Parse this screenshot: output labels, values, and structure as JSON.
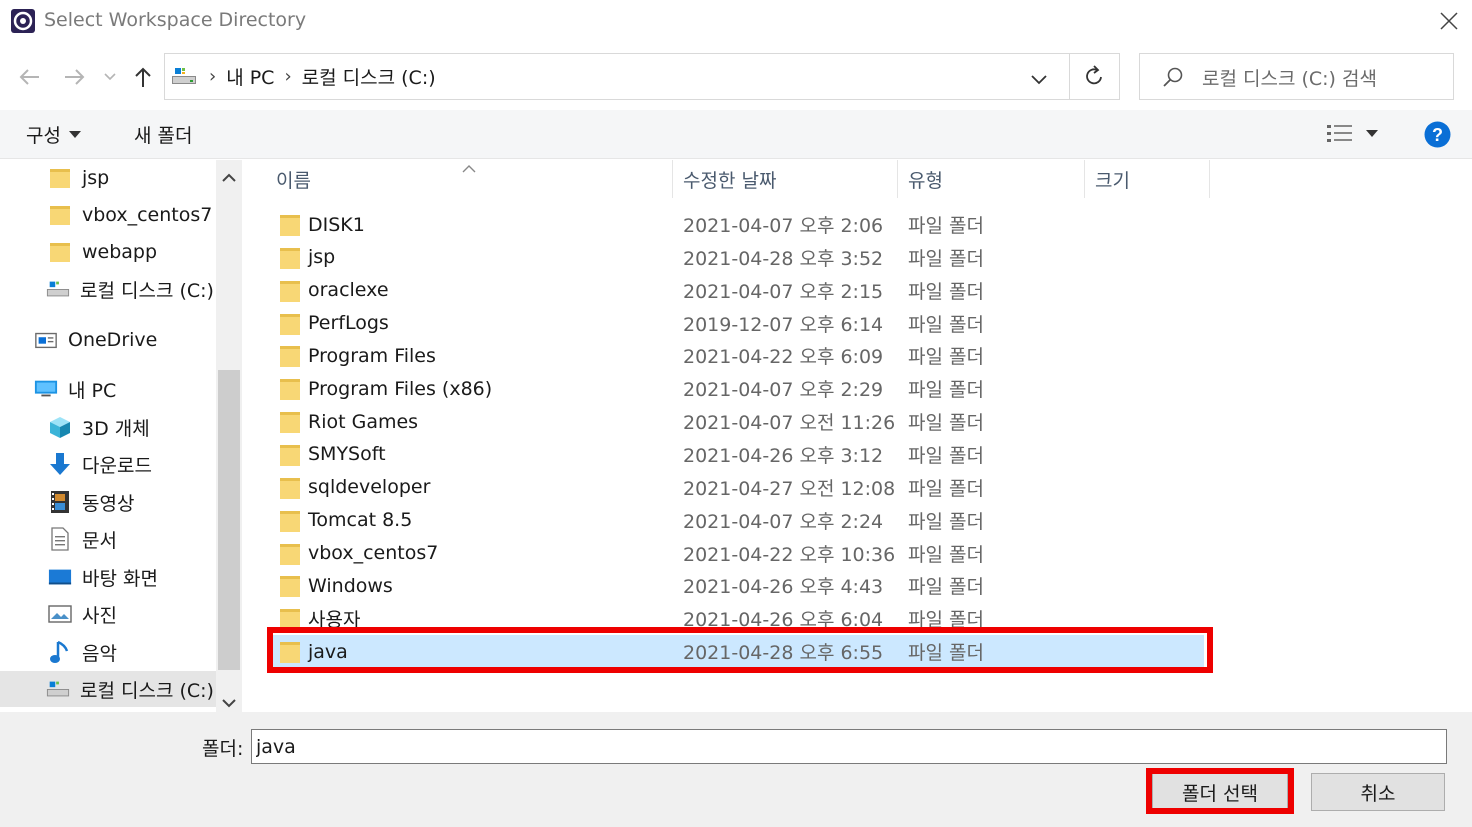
{
  "window": {
    "title": "Select Workspace Directory"
  },
  "address": {
    "crumbs": [
      "내 PC",
      "로컬 디스크 (C:)"
    ],
    "search_placeholder": "로컬 디스크 (C:) 검색"
  },
  "commands": {
    "organize": "구성",
    "new_folder": "새 폴더"
  },
  "nav": {
    "items": [
      {
        "label": "jsp",
        "icon": "folder-icon"
      },
      {
        "label": "vbox_centos7",
        "icon": "folder-icon"
      },
      {
        "label": "webapp",
        "icon": "folder-icon"
      },
      {
        "label": "로컬 디스크 (C:)",
        "icon": "drive-icon"
      },
      {
        "label": "OneDrive",
        "icon": "onedrive-icon"
      },
      {
        "label": "내 PC",
        "icon": "pc-icon"
      },
      {
        "label": "3D 개체",
        "icon": "cube-icon"
      },
      {
        "label": "다운로드",
        "icon": "download-icon"
      },
      {
        "label": "동영상",
        "icon": "video-icon"
      },
      {
        "label": "문서",
        "icon": "document-icon"
      },
      {
        "label": "바탕 화면",
        "icon": "desktop-icon"
      },
      {
        "label": "사진",
        "icon": "picture-icon"
      },
      {
        "label": "음악",
        "icon": "music-icon"
      },
      {
        "label": "로컬 디스크 (C:)",
        "icon": "drive-icon"
      }
    ]
  },
  "columns": {
    "name": "이름",
    "date": "수정한 날짜",
    "type": "유형",
    "size": "크기"
  },
  "files": [
    {
      "name": "DISK1",
      "date": "2021-04-07 오후 2:06",
      "type": "파일 폴더"
    },
    {
      "name": "jsp",
      "date": "2021-04-28 오후 3:52",
      "type": "파일 폴더"
    },
    {
      "name": "oraclexe",
      "date": "2021-04-07 오후 2:15",
      "type": "파일 폴더"
    },
    {
      "name": "PerfLogs",
      "date": "2019-12-07 오후 6:14",
      "type": "파일 폴더"
    },
    {
      "name": "Program Files",
      "date": "2021-04-22 오후 6:09",
      "type": "파일 폴더"
    },
    {
      "name": "Program Files (x86)",
      "date": "2021-04-07 오후 2:29",
      "type": "파일 폴더"
    },
    {
      "name": "Riot Games",
      "date": "2021-04-07 오전 11:26",
      "type": "파일 폴더"
    },
    {
      "name": "SMYSoft",
      "date": "2021-04-26 오후 3:12",
      "type": "파일 폴더"
    },
    {
      "name": "sqldeveloper",
      "date": "2021-04-27 오전 12:08",
      "type": "파일 폴더"
    },
    {
      "name": "Tomcat 8.5",
      "date": "2021-04-07 오후 2:24",
      "type": "파일 폴더"
    },
    {
      "name": "vbox_centos7",
      "date": "2021-04-22 오후 10:36",
      "type": "파일 폴더"
    },
    {
      "name": "Windows",
      "date": "2021-04-26 오후 4:43",
      "type": "파일 폴더"
    },
    {
      "name": "사용자",
      "date": "2021-04-26 오후 6:04",
      "type": "파일 폴더"
    },
    {
      "name": "java",
      "date": "2021-04-28 오후 6:55",
      "type": "파일 폴더"
    }
  ],
  "footer": {
    "folder_label": "폴더:",
    "folder_value": "java",
    "select_button": "폴더 선택",
    "cancel_button": "취소"
  },
  "colors": {
    "selection": "#cce8ff",
    "highlight": "#ee0000",
    "folder": "#f8d775",
    "accent": "#0078d7"
  }
}
